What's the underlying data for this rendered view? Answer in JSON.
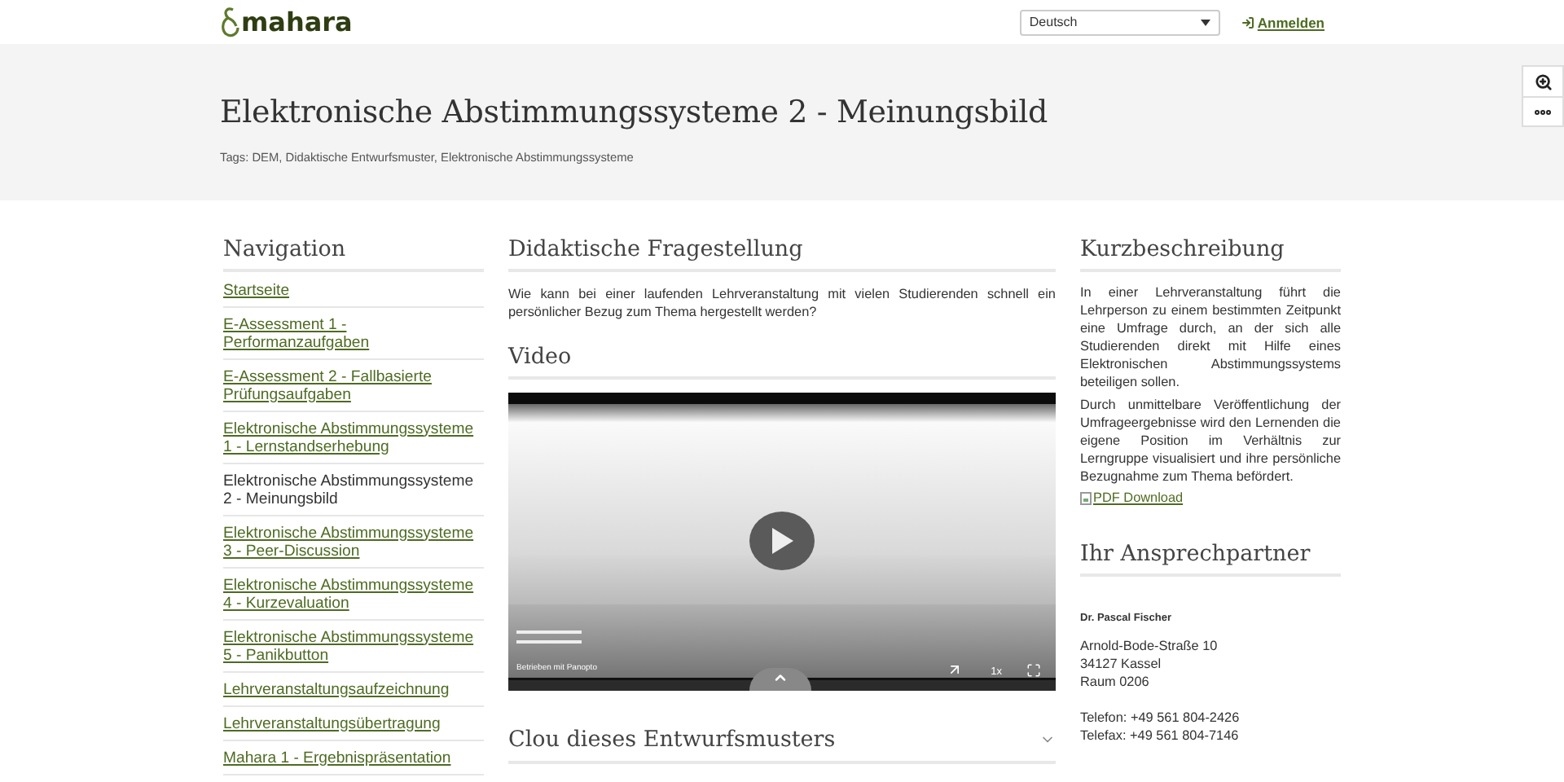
{
  "header": {
    "logo": "mahara",
    "language": {
      "value": "Deutsch"
    },
    "login": "Anmelden"
  },
  "banner": {
    "title": "Elektronische Abstimmungssysteme 2 - Meinungsbild",
    "tags": "Tags: DEM, Didaktische Entwurfsmuster, Elektronische Abstimmungssysteme"
  },
  "navigation": {
    "title": "Navigation",
    "items": [
      {
        "label": "Startseite",
        "selected": false
      },
      {
        "label": "E-Assessment 1 - Performanzaufgaben",
        "selected": false
      },
      {
        "label": "E-Assessment 2 - Fallbasierte Prüfungsaufgaben",
        "selected": false
      },
      {
        "label": "Elektronische Abstimmungssysteme 1 - Lernstandserhebung",
        "selected": false
      },
      {
        "label": "Elektronische Abstimmungssysteme 2 - Meinungsbild",
        "selected": true
      },
      {
        "label": "Elektronische Abstimmungssysteme 3 - Peer-Discussion",
        "selected": false
      },
      {
        "label": "Elektronische Abstimmungssysteme 4 - Kurzevaluation",
        "selected": false
      },
      {
        "label": "Elektronische Abstimmungssysteme 5 - Panikbutton",
        "selected": false
      },
      {
        "label": "Lehrveranstaltungsaufzeichnung",
        "selected": false
      },
      {
        "label": "Lehrveranstaltungsübertragung",
        "selected": false
      },
      {
        "label": "Mahara 1 - Ergebnispräsentation",
        "selected": false
      }
    ]
  },
  "question": {
    "title": "Didaktische Fragestellung",
    "text": "Wie kann bei einer laufenden Lehrveranstaltung mit vielen Studierenden schnell ein persönlicher Bezug zum Thema hergestellt werden?"
  },
  "video": {
    "title": "Video",
    "powered_by": "Betrieben mit Panopto",
    "speed": "1x"
  },
  "accordion": {
    "title": "Clou dieses Entwurfsmusters",
    "expanded": false
  },
  "summary": {
    "title": "Kurzbeschreibung",
    "paragraphs": [
      "In einer Lehrveranstaltung führt die Lehrperson zu einem bestimmten Zeitpunkt eine Umfrage durch, an der sich alle Studierenden direkt mit Hilfe eines Elektronischen Abstimmungssystems beteiligen sollen.",
      "Durch unmittelbare Veröffentlichung der Umfrageergebnisse wird den Lernenden die eigene Position im Verhältnis zur Lerngruppe visualisiert und ihre persönliche Bezugnahme zum Thema befördert."
    ],
    "pdf_link": "PDF Download"
  },
  "contact": {
    "title": "Ihr Ansprechpartner",
    "name": "Dr. Pascal Fischer",
    "address": [
      "Arnold-Bode-Straße 10",
      "34127 Kassel",
      "Raum 0206"
    ],
    "phones": [
      "Telefon: +49 561 804-2426",
      "Telefax: +49 561 804-7146"
    ]
  }
}
